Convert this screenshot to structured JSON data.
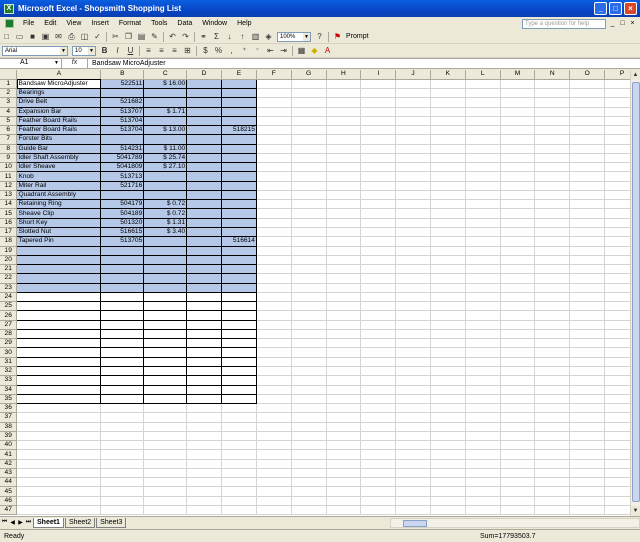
{
  "window": {
    "title": "Microsoft Excel - Shopsmith Shopping List"
  },
  "menu": {
    "items": [
      "File",
      "Edit",
      "View",
      "Insert",
      "Format",
      "Tools",
      "Data",
      "Window",
      "Help"
    ],
    "help_placeholder": "Type a question for help"
  },
  "toolbar": {
    "zoom": "100%",
    "prompt_label": "Prompt",
    "font_name": "Arial",
    "font_size": "10",
    "bold": "B",
    "italic": "I",
    "underline": "U"
  },
  "formula_bar": {
    "name_box": "A1",
    "fx": "fx",
    "content": "Bandsaw MicroAdjuster"
  },
  "sheet": {
    "columns": [
      "A",
      "B",
      "C",
      "D",
      "E",
      "F",
      "G",
      "H",
      "I",
      "J",
      "K",
      "L",
      "M",
      "N",
      "O",
      "P"
    ],
    "rows": [
      {
        "n": "1",
        "a": "Bandsaw MicroAdjuster",
        "b": "522511",
        "c": "$ 16.00",
        "d": "",
        "e": ""
      },
      {
        "n": "2",
        "a": "Bearings",
        "b": "",
        "c": "",
        "d": "",
        "e": ""
      },
      {
        "n": "3",
        "a": "Drive Belt",
        "b": "521682",
        "c": "",
        "d": "",
        "e": ""
      },
      {
        "n": "4",
        "a": "Expansion Bar",
        "b": "513707",
        "c": "$   1.71",
        "d": "",
        "e": ""
      },
      {
        "n": "5",
        "a": "Feather Board Rails",
        "b": "513704",
        "c": "",
        "d": "",
        "e": ""
      },
      {
        "n": "6",
        "a": "Feather Board Rails",
        "b": "513704",
        "c": "$ 13.00",
        "d": "",
        "e": "518215"
      },
      {
        "n": "7",
        "a": "Forster Bits",
        "b": "",
        "c": "",
        "d": "",
        "e": ""
      },
      {
        "n": "8",
        "a": "Guide Bar",
        "b": "514231",
        "c": "$ 11.00",
        "d": "",
        "e": ""
      },
      {
        "n": "9",
        "a": "Idler Shaft Assembly",
        "b": "5041789",
        "c": "$ 25.74",
        "d": "",
        "e": ""
      },
      {
        "n": "10",
        "a": "Idler Sheave",
        "b": "5041809",
        "c": "$ 27.10",
        "d": "",
        "e": ""
      },
      {
        "n": "11",
        "a": "Knob",
        "b": "513713",
        "c": "",
        "d": "",
        "e": ""
      },
      {
        "n": "12",
        "a": "Miter Rail",
        "b": "521716",
        "c": "",
        "d": "",
        "e": ""
      },
      {
        "n": "13",
        "a": "Quadrant Assembly",
        "b": "",
        "c": "",
        "d": "",
        "e": ""
      },
      {
        "n": "14",
        "a": "Retaining Ring",
        "b": "504179",
        "c": "$   0.72",
        "d": "",
        "e": ""
      },
      {
        "n": "15",
        "a": "Sheave Clip",
        "b": "504189",
        "c": "$   0.72",
        "d": "",
        "e": ""
      },
      {
        "n": "16",
        "a": "Short Key",
        "b": "501320",
        "c": "$   1.31",
        "d": "",
        "e": ""
      },
      {
        "n": "17",
        "a": "Slotted Nut",
        "b": "516615",
        "c": "$   3.40",
        "d": "",
        "e": ""
      },
      {
        "n": "18",
        "a": "Tapered Pin",
        "b": "513705",
        "c": "",
        "d": "",
        "e": "516614"
      }
    ],
    "total_rows": 47,
    "selected_rows": 23,
    "bordered_rows": 35
  },
  "tabs": [
    "Sheet1",
    "Sheet2",
    "Sheet3"
  ],
  "status": {
    "ready": "Ready",
    "sum": "Sum=17793503.7"
  },
  "colors": {
    "title_bar": "#0a5fe0",
    "selection": "#b5c8e8"
  }
}
